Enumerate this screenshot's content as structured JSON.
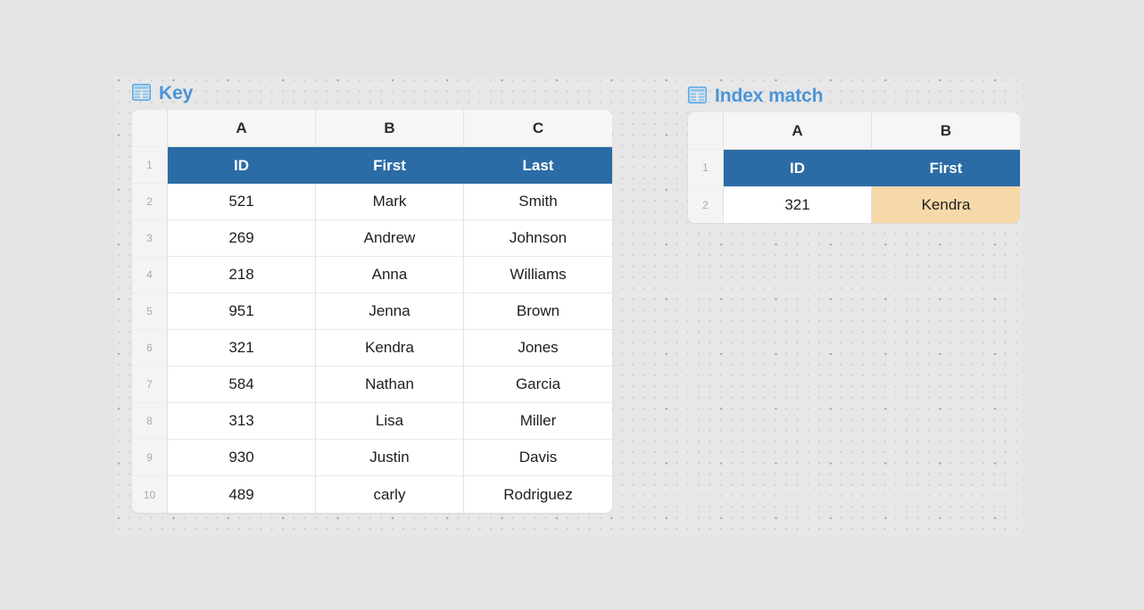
{
  "canvas": {
    "background_color": "#e7e7e7",
    "page_background_color": "#e4e4e4"
  },
  "theme": {
    "title_blue": "#4a94d8",
    "header_blue": "#2b6ca6",
    "highlight_orange": "#f7d9a9",
    "grid_line": "#e3e3e3"
  },
  "tables": [
    {
      "title": "Key",
      "icon": "table-grid-icon",
      "column_letters": [
        "A",
        "B",
        "C"
      ],
      "row_numbers": [
        "1",
        "2",
        "3",
        "4",
        "5",
        "6",
        "7",
        "8",
        "9",
        "10"
      ],
      "header_row": [
        "ID",
        "First",
        "Last"
      ],
      "rows": [
        [
          "521",
          "Mark",
          "Smith"
        ],
        [
          "269",
          "Andrew",
          "Johnson"
        ],
        [
          "218",
          "Anna",
          "Williams"
        ],
        [
          "951",
          "Jenna",
          "Brown"
        ],
        [
          "321",
          "Kendra",
          "Jones"
        ],
        [
          "584",
          "Nathan",
          "Garcia"
        ],
        [
          "313",
          "Lisa",
          "Miller"
        ],
        [
          "930",
          "Justin",
          "Davis"
        ],
        [
          "489",
          "carly",
          "Rodriguez"
        ]
      ]
    },
    {
      "title": "Index match",
      "icon": "table-grid-icon",
      "column_letters": [
        "A",
        "B"
      ],
      "row_numbers": [
        "1",
        "2"
      ],
      "header_row": [
        "ID",
        "First"
      ],
      "rows": [
        [
          "321",
          "Kendra"
        ]
      ],
      "highlighted_cell": "Kendra"
    }
  ]
}
